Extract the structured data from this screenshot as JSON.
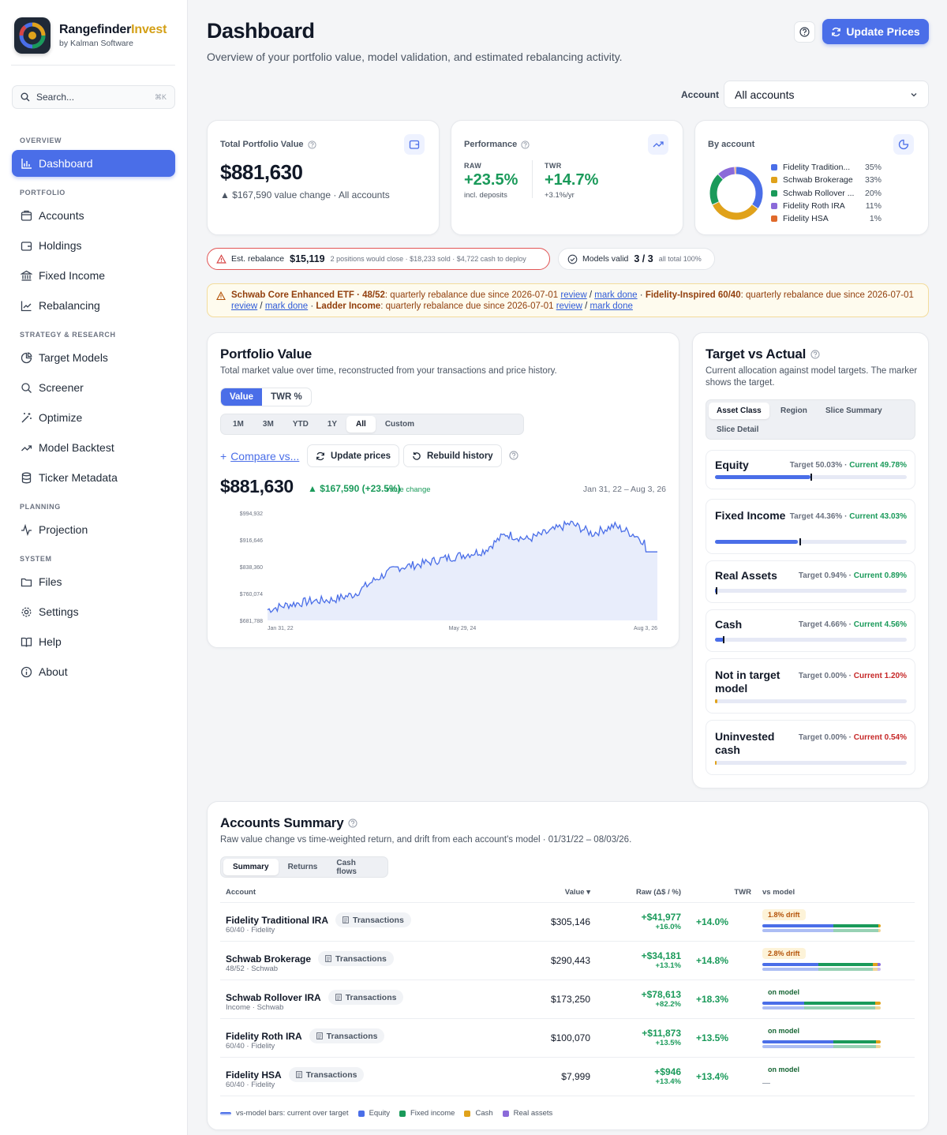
{
  "brand": {
    "name_main": "Rangefinder",
    "name_accent": "Invest",
    "subtitle": "by Kalman Software"
  },
  "search": {
    "placeholder": "Search...",
    "shortcut": "⌘K"
  },
  "nav": {
    "sections": {
      "overview": "OVERVIEW",
      "portfolio": "PORTFOLIO",
      "strategy": "STRATEGY & RESEARCH",
      "planning": "PLANNING",
      "system": "SYSTEM"
    },
    "items": {
      "dashboard": "Dashboard",
      "accounts": "Accounts",
      "holdings": "Holdings",
      "fixed_income": "Fixed Income",
      "rebalancing": "Rebalancing",
      "target_models": "Target Models",
      "screener": "Screener",
      "optimize": "Optimize",
      "model_backtest": "Model Backtest",
      "ticker_metadata": "Ticker Metadata",
      "projection": "Projection",
      "files": "Files",
      "settings": "Settings",
      "help": "Help",
      "about": "About"
    }
  },
  "header": {
    "title": "Dashboard",
    "subtitle": "Overview of your portfolio value, model validation, and estimated rebalancing activity.",
    "update_button": "Update Prices",
    "account_label": "Account",
    "account_value": "All accounts"
  },
  "kpi": {
    "total": {
      "label": "Total Portfolio Value",
      "value": "$881,630",
      "change": "▲ $167,590 value change · All accounts"
    },
    "performance": {
      "label": "Performance",
      "raw_label": "RAW",
      "raw_value": "+23.5%",
      "raw_note": "incl. deposits",
      "twr_label": "TWR",
      "twr_value": "+14.7%",
      "twr_note": "+3.1%/yr"
    },
    "by_account": {
      "label": "By account",
      "items": [
        {
          "name": "Fidelity Tradition...",
          "pct": "35%",
          "value": 35,
          "color": "#4a6ee8"
        },
        {
          "name": "Schwab Brokerage",
          "pct": "33%",
          "value": 33,
          "color": "#e0a21b"
        },
        {
          "name": "Schwab Rollover ...",
          "pct": "20%",
          "value": 20,
          "color": "#1a9a5a"
        },
        {
          "name": "Fidelity Roth IRA",
          "pct": "11%",
          "value": 11,
          "color": "#8b6ad9"
        },
        {
          "name": "Fidelity HSA",
          "pct": "1%",
          "value": 1,
          "color": "#e06a2b"
        }
      ]
    }
  },
  "pills": {
    "rebalance": {
      "label": "Est. rebalance",
      "value": "$15,119",
      "note": "2 positions would close · $18,233 sold · $4,722 cash to deploy"
    },
    "models": {
      "label": "Models valid",
      "value": "3 / 3",
      "note": "all total 100%"
    }
  },
  "notice": {
    "m1": "Schwab Core Enhanced ETF · 48/52",
    "t1": ": quarterly rebalance due since 2026-07-01 ",
    "m2": "Fidelity-Inspired 60/40",
    "t2": ": quarterly rebalance due since 2026-07-01 ",
    "m3": "Ladder Income",
    "t3": ": quarterly rebalance due since 2026-07-01 ",
    "review": "review",
    "mark_done": "mark done",
    "slash": " / ",
    "dot": " · "
  },
  "portfolio_value": {
    "title": "Portfolio Value",
    "subtitle": "Total market value over time, reconstructed from your transactions and price history.",
    "mode_tabs": [
      "Value",
      "TWR %"
    ],
    "ranges": [
      "1M",
      "3M",
      "YTD",
      "1Y",
      "All",
      "Custom"
    ],
    "active_range": "All",
    "compare": "Compare vs...",
    "update_prices": "Update prices",
    "rebuild_history": "Rebuild history",
    "value": "$881,630",
    "change": "▲ $167,590 (+23.5%)",
    "change_label": "value change",
    "range_text": "Jan 31, 22 – Aug 3, 26"
  },
  "chart_data": {
    "type": "area",
    "title": "Portfolio Value",
    "y_ticks": [
      "$994,932",
      "$916,646",
      "$838,360",
      "$760,074",
      "$681,788"
    ],
    "x_ticks": [
      "Jan 31, 22",
      "May 29, 24",
      "Aug 3, 26"
    ],
    "ylim": [
      681788,
      994932
    ],
    "x": [
      "2022-01-31",
      "2022-04",
      "2022-07",
      "2022-10",
      "2023-01",
      "2023-04",
      "2023-07",
      "2023-10",
      "2024-01",
      "2024-04",
      "2024-07",
      "2024-10",
      "2025-01",
      "2025-04",
      "2025-07",
      "2025-10",
      "2026-01",
      "2026-04",
      "2026-08-03"
    ],
    "values": [
      713000,
      728000,
      738000,
      742000,
      758000,
      802000,
      836000,
      845000,
      860000,
      872000,
      885000,
      934000,
      918000,
      940000,
      965000,
      935000,
      958000,
      930000,
      881630
    ],
    "grid": false,
    "colors": {
      "line": "#4a6ee8",
      "fill": "#e8edfb"
    }
  },
  "target_vs_actual": {
    "title": "Target vs Actual",
    "subtitle": "Current allocation against model targets. The marker shows the target.",
    "tabs": [
      "Asset Class",
      "Region",
      "Slice Summary",
      "Slice Detail"
    ],
    "items": [
      {
        "name": "Equity",
        "target_text": "Target 50.03%",
        "current_text": "Current 49.78%",
        "target": 50.03,
        "current": 49.78,
        "color": "#4a6ee8",
        "status": "green"
      },
      {
        "name": "Fixed Income",
        "target_text": "Target 44.36%",
        "current_text": "Current 43.03%",
        "target": 44.36,
        "current": 43.03,
        "color": "#4a6ee8",
        "status": "green"
      },
      {
        "name": "Real Assets",
        "target_text": "Target 0.94%",
        "current_text": "Current 0.89%",
        "target": 0.94,
        "current": 0.89,
        "color": "#4a6ee8",
        "status": "green"
      },
      {
        "name": "Cash",
        "target_text": "Target 4.66%",
        "current_text": "Current 4.56%",
        "target": 4.66,
        "current": 4.56,
        "color": "#4a6ee8",
        "status": "green"
      },
      {
        "name": "Not in target model",
        "target_text": "Target 0.00%",
        "current_text": "Current 1.20%",
        "target": 0,
        "current": 1.2,
        "color": "#e0a21b",
        "status": "red"
      },
      {
        "name": "Uninvested cash",
        "target_text": "Target 0.00%",
        "current_text": "Current 0.54%",
        "target": 0,
        "current": 0.54,
        "color": "#e0a21b",
        "status": "red"
      }
    ],
    "separator": " · "
  },
  "accounts_summary": {
    "title": "Accounts Summary",
    "subtitle": "Raw value change vs time-weighted return, and drift from each account's model · 01/31/22 – 08/03/26.",
    "tabs": [
      "Summary",
      "Returns",
      "Cash flows"
    ],
    "headers": {
      "account": "Account",
      "value": "Value ▾",
      "raw": "Raw (Δ$ / %)",
      "twr": "TWR",
      "model": "vs model"
    },
    "tag_label": "Transactions",
    "rows": [
      {
        "name": "Fidelity Traditional IRA",
        "sub": "60/40 · Fidelity",
        "value": "$305,146",
        "raw_d": "+$41,977",
        "raw_p": "+16.0%",
        "twr": "+14.0%",
        "drift": "1.8% drift",
        "drift_kind": "warn",
        "mix": [
          60,
          38,
          2,
          0
        ]
      },
      {
        "name": "Schwab Brokerage",
        "sub": "48/52 · Schwab",
        "value": "$290,443",
        "raw_d": "+$34,181",
        "raw_p": "+13.1%",
        "twr": "+14.8%",
        "drift": "2.8% drift",
        "drift_kind": "warn",
        "mix": [
          47,
          46,
          4,
          3
        ]
      },
      {
        "name": "Schwab Rollover IRA",
        "sub": "Income · Schwab",
        "value": "$173,250",
        "raw_d": "+$78,613",
        "raw_p": "+82.2%",
        "twr": "+18.3%",
        "drift": "on model",
        "drift_kind": "ok",
        "mix": [
          35,
          60,
          5,
          0
        ]
      },
      {
        "name": "Fidelity Roth IRA",
        "sub": "60/40 · Fidelity",
        "value": "$100,070",
        "raw_d": "+$11,873",
        "raw_p": "+13.5%",
        "twr": "+13.5%",
        "drift": "on model",
        "drift_kind": "ok",
        "mix": [
          60,
          36,
          4,
          0
        ]
      },
      {
        "name": "Fidelity HSA",
        "sub": "60/40 · Fidelity",
        "value": "$7,999",
        "raw_d": "+$946",
        "raw_p": "+13.4%",
        "twr": "+13.4%",
        "drift": "on model",
        "drift_kind": "ok",
        "mix": [
          0,
          0,
          0,
          0
        ]
      }
    ],
    "legend": {
      "bars": "vs-model bars: current over target",
      "equity": "Equity",
      "fixed": "Fixed income",
      "cash": "Cash",
      "real": "Real assets"
    },
    "mix_colors": [
      "#4a6ee8",
      "#1a9a5a",
      "#e0a21b",
      "#8b6ad9"
    ]
  }
}
